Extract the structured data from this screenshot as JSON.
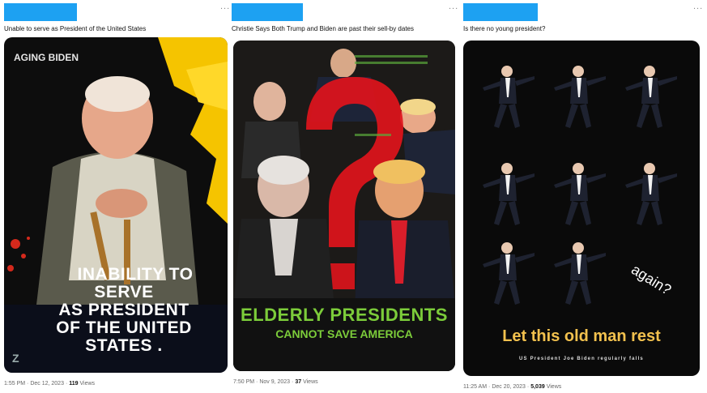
{
  "posts": [
    {
      "caption": "Unable to serve as President of the United States",
      "image": {
        "top_label": "AGING BIDEN",
        "headline_lines": [
          "INABILITY TO",
          "SERVE",
          "AS PRESIDENT",
          "OF THE UNITED",
          "STATES ."
        ],
        "corner_mark": "Z"
      },
      "time": "1:55 PM",
      "date": "Dec 12, 2023",
      "views_count": "119",
      "views_label": "Views"
    },
    {
      "caption": "Christie Says Both Trump and Biden are past their sell-by dates",
      "image": {
        "headline": "ELDERLY PRESIDENTS",
        "subheadline": "CANNOT SAVE AMERICA",
        "accent_color": "#e0141c",
        "headline_color": "#7ccc3a"
      },
      "time": "7:50 PM",
      "date": "Nov 9, 2023",
      "views_count": "37",
      "views_label": "Views"
    },
    {
      "caption": "Is there no young president?",
      "image": {
        "tilted_text": "again?",
        "headline": "Let this old man rest",
        "subline": "US President Joe Biden regularly falls",
        "headline_color": "#f2c14e",
        "figure_count": 8
      },
      "time": "11:25 AM",
      "date": "Dec 20, 2023",
      "views_count": "5,039",
      "views_label": "Views"
    }
  ],
  "ui": {
    "more_glyph": "...",
    "separator": "·",
    "accent": "#1da1f2"
  }
}
